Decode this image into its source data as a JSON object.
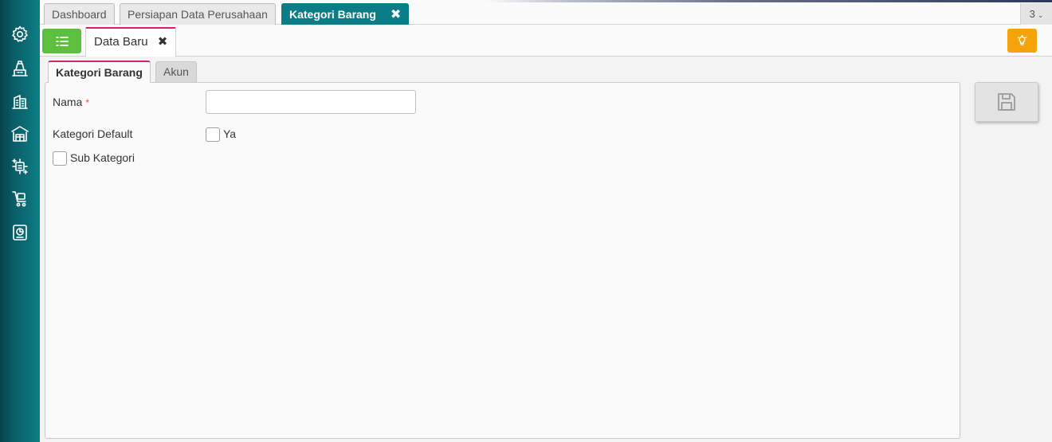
{
  "sidebar": {
    "icons": [
      "gear-icon",
      "office-building-icon",
      "company-building-icon",
      "warehouse-icon",
      "transfer-icon",
      "cart-icon",
      "report-icon"
    ]
  },
  "top_tabs": [
    {
      "label": "Dashboard",
      "active": false
    },
    {
      "label": "Persiapan Data Perusahaan",
      "active": false
    },
    {
      "label": "Kategori Barang",
      "active": true,
      "close": "✖"
    }
  ],
  "tab_count": "3",
  "toolbar": {
    "doc_tab_label": "Data Baru",
    "doc_tab_close": "✖"
  },
  "form_tabs": [
    {
      "label": "Kategori Barang",
      "active": true
    },
    {
      "label": "Akun",
      "active": false
    }
  ],
  "form": {
    "nama_label": "Nama",
    "required_mark": "*",
    "nama_value": "",
    "kategori_default_label": "Kategori Default",
    "ya_label": "Ya",
    "kategori_default_checked": false,
    "sub_kategori_label": "Sub Kategori",
    "sub_kategori_checked": false
  },
  "colors": {
    "active_tab": "#0b7d86",
    "list_button": "#5cbf3e",
    "tip_button": "#f5a30a",
    "tab_accent": "#d2236e"
  }
}
